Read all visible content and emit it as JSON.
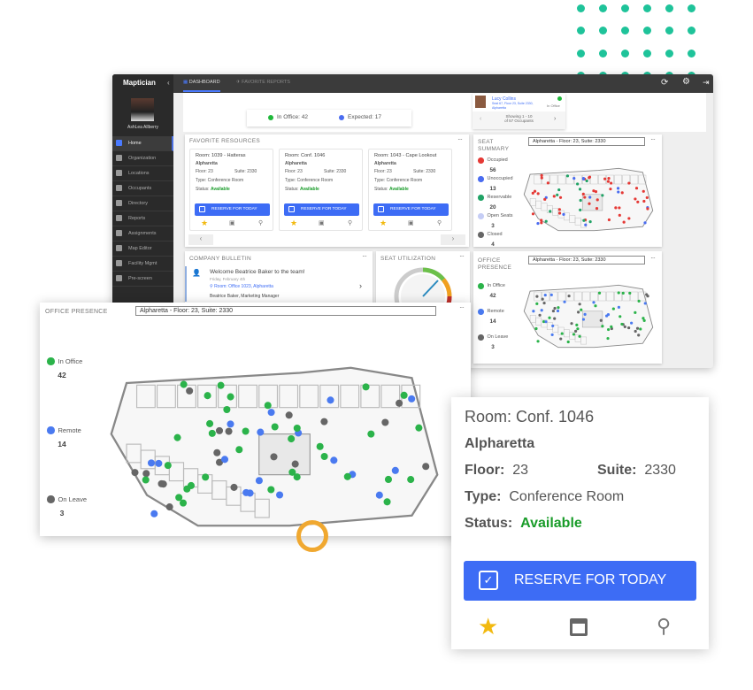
{
  "app": {
    "brand": "Maptician",
    "user": "AshLea Allberry"
  },
  "tabs": [
    {
      "label": "DASHBOARD",
      "active": true
    },
    {
      "label": "FAVORITE REPORTS",
      "active": false
    }
  ],
  "sidebar": {
    "items": [
      {
        "label": "Home",
        "active": true
      },
      {
        "label": "Organization"
      },
      {
        "label": "Locations"
      },
      {
        "label": "Occupants"
      },
      {
        "label": "Directory"
      },
      {
        "label": "Reports"
      },
      {
        "label": "Assignments"
      },
      {
        "label": "Map Editor"
      },
      {
        "label": "Facility Mgmt"
      },
      {
        "label": "Pre-screen"
      }
    ]
  },
  "status_bar": {
    "in_office": "In Office: 42",
    "expected": "Expected: 17"
  },
  "occupant": {
    "name": "Lucy Collins",
    "detail": "Seat 67, Floor 23, Suite 2330, Alpharetta",
    "status": "In Office",
    "showing": "Showing 1 - 10",
    "of": "of 57 Occupants"
  },
  "favorites": {
    "title": "FAVORITE RESOURCES",
    "items": [
      {
        "room": "Room: 1039 - Hatteras",
        "city": "Alpharetta",
        "floor": "23",
        "suite": "2330",
        "type": "Conference Room",
        "status": "Available"
      },
      {
        "room": "Room: Conf. 1046",
        "city": "Alpharetta",
        "floor": "23",
        "suite": "2330",
        "type": "Conference Room",
        "status": "Available"
      },
      {
        "room": "Room: 1043 - Cape Lookout",
        "city": "Alpharetta",
        "floor": "23",
        "suite": "2330",
        "type": "Conference Room",
        "status": "Available"
      }
    ],
    "labels": {
      "floor": "Floor:",
      "suite": "Suite:",
      "type": "Type:",
      "status": "Status:",
      "reserve": "RESERVE FOR TODAY"
    }
  },
  "seat_summary": {
    "title": "SEAT SUMMARY",
    "location": "Alpharetta - Floor: 23, Suite: 2330",
    "legend": [
      {
        "label": "Occupied",
        "value": "56",
        "color": "#e53935"
      },
      {
        "label": "Unoccupied",
        "value": "13",
        "color": "#4a6cf0"
      },
      {
        "label": "Reservable",
        "value": "20",
        "color": "#21a366"
      },
      {
        "label": "Open Seats",
        "value": "3",
        "color": "#c5cdf5"
      },
      {
        "label": "Closed",
        "value": "4",
        "color": "#666666"
      }
    ]
  },
  "office_presence": {
    "title": "OFFICE PRESENCE",
    "location": "Alpharetta - Floor: 23, Suite: 2330",
    "legend": [
      {
        "label": "In Office",
        "value": "42",
        "color": "#2bb34a"
      },
      {
        "label": "Remote",
        "value": "14",
        "color": "#4a7af0"
      },
      {
        "label": "On Leave",
        "value": "3",
        "color": "#666666"
      }
    ]
  },
  "bulletin": {
    "title": "COMPANY BULLETIN",
    "headline": "Welcome Beatrice Baker to the team!",
    "date": "Friday, February 4th",
    "room": "Room: Office 1023, Alpharetta",
    "person": "Beatrice Baker, Marketing Manager"
  },
  "utilization": {
    "title": "SEAT UTILIZATION"
  },
  "room_card": {
    "room": "Room: Conf. 1046",
    "city": "Alpharetta",
    "floor_label": "Floor:",
    "floor": "23",
    "suite_label": "Suite:",
    "suite": "2330",
    "type_label": "Type:",
    "type": "Conference Room",
    "status_label": "Status:",
    "status": "Available",
    "reserve": "RESERVE FOR TODAY"
  },
  "colors": {
    "accent": "#3d6cf5",
    "available": "#1a9c2a",
    "teal_dots": "#1fc39a",
    "marker": "#f0a830"
  }
}
